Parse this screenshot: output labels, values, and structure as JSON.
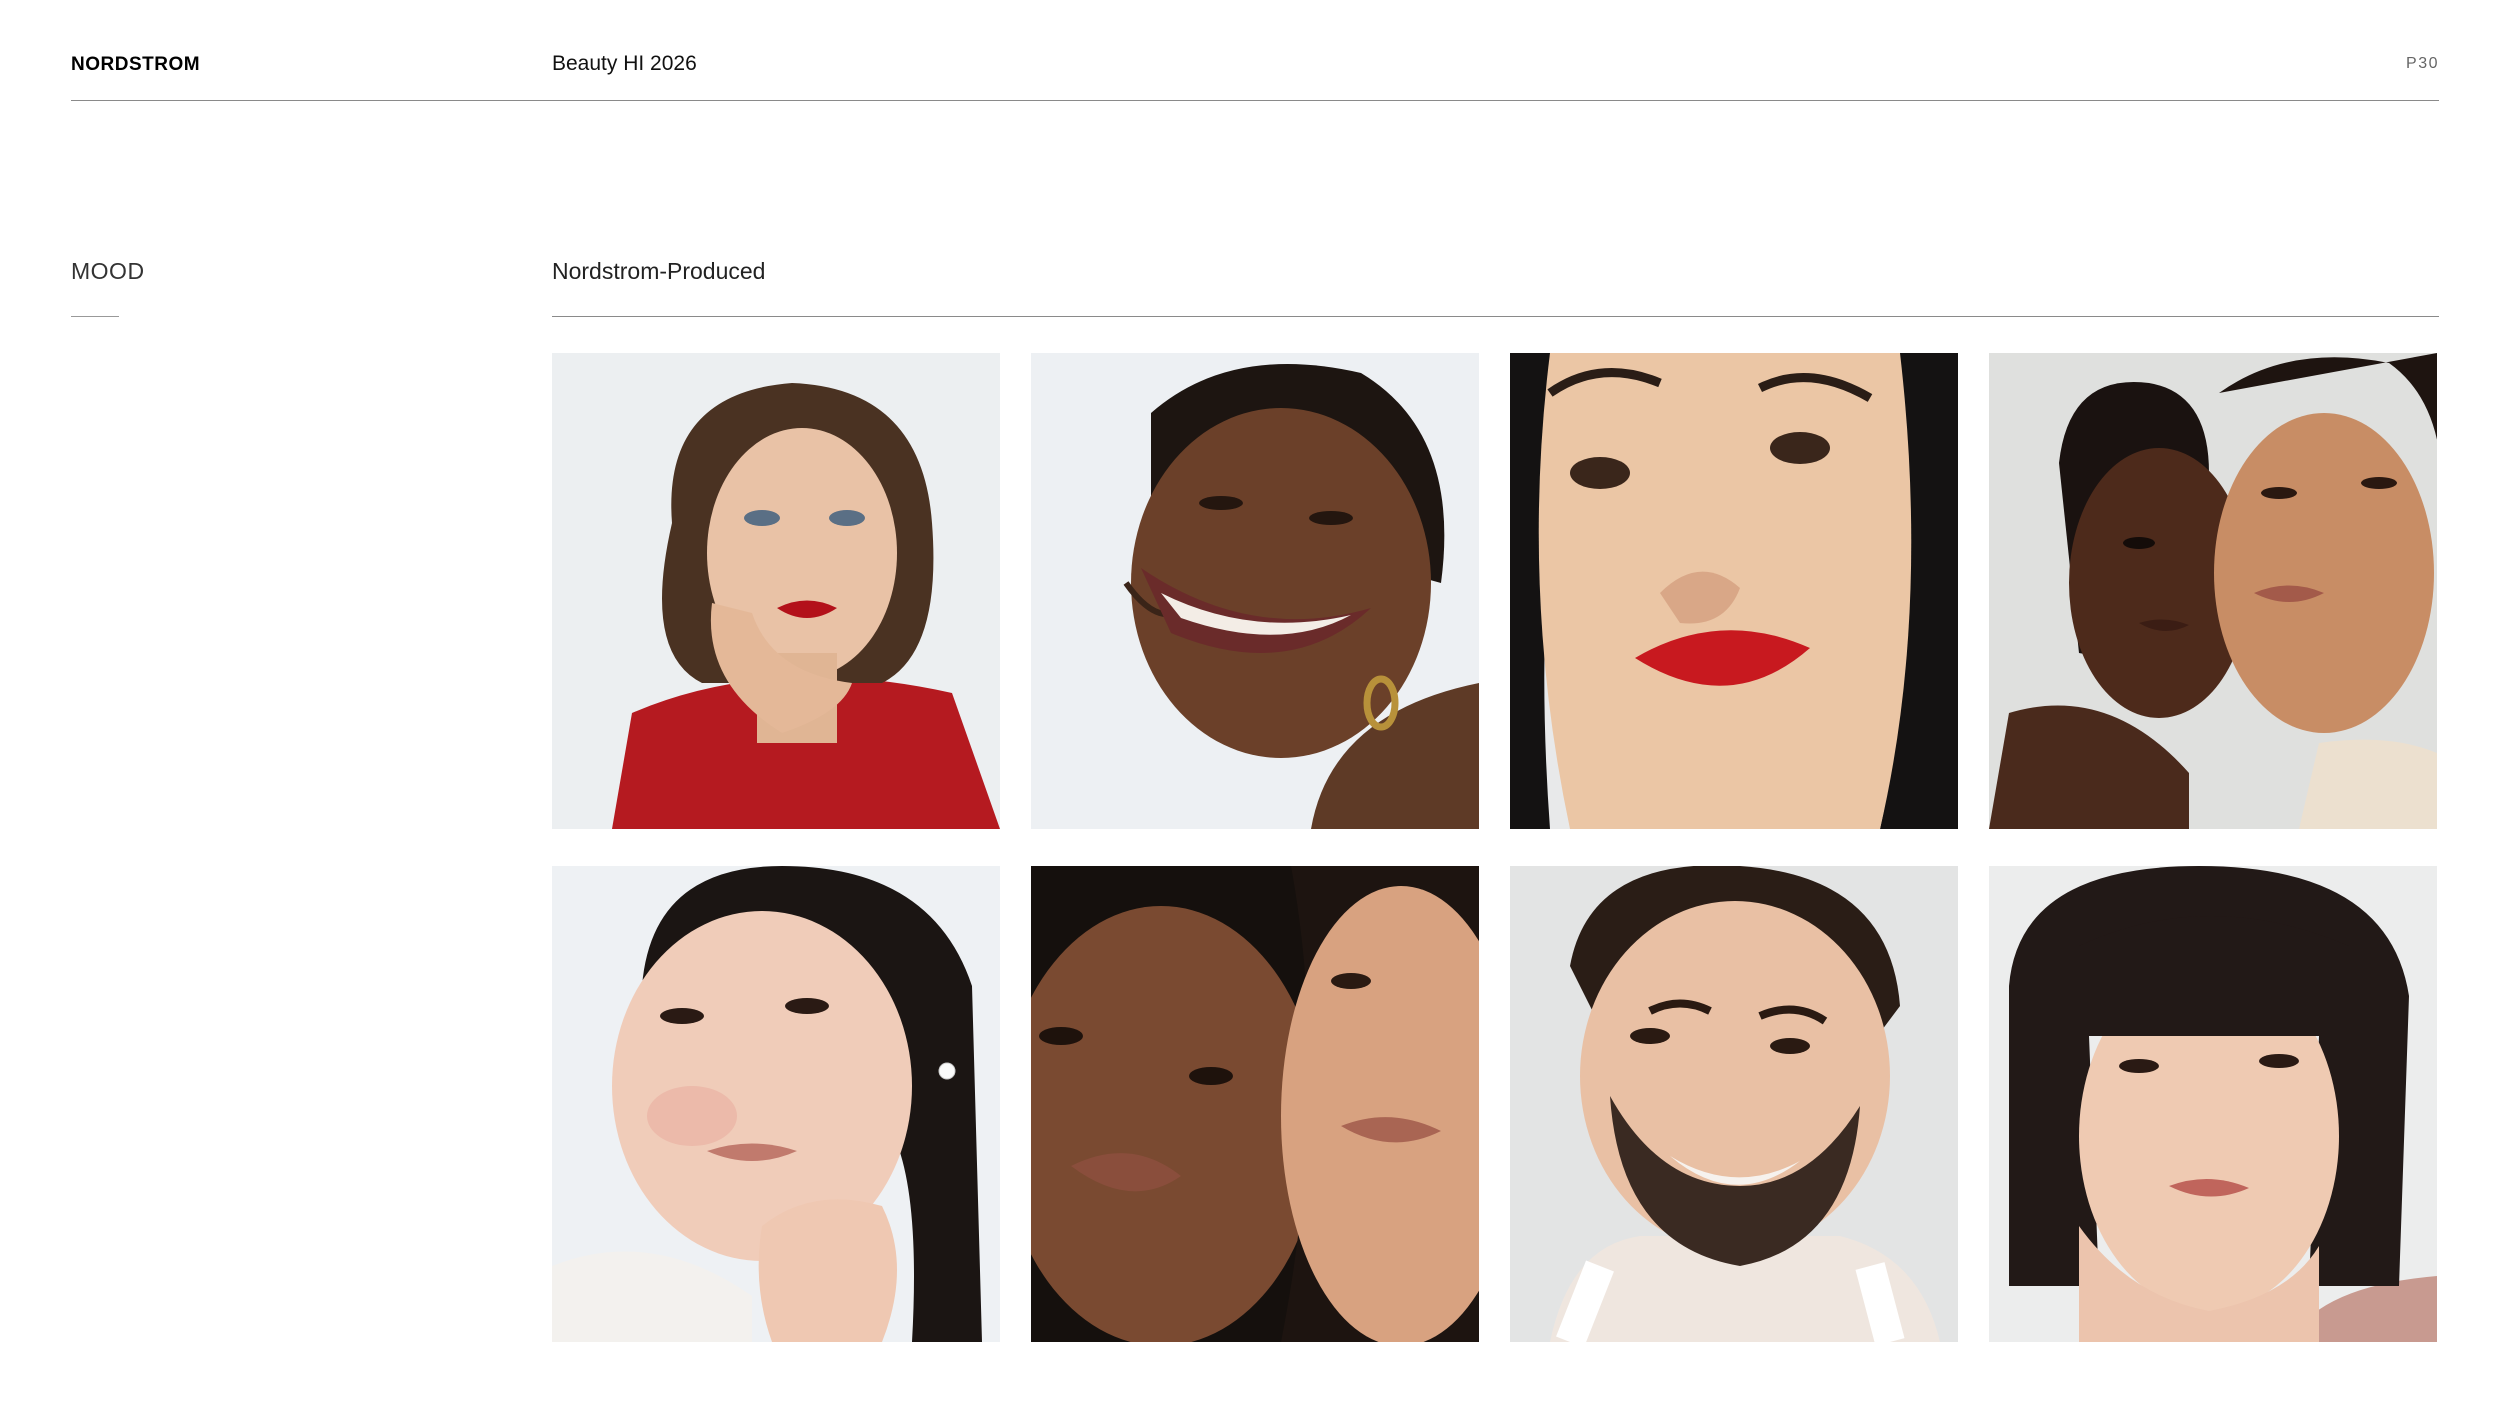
{
  "header": {
    "brand": "NORDSTROM",
    "title": "Beauty HI 2026",
    "page_number": "P30"
  },
  "section": {
    "label": "MOOD",
    "subtitle": "Nordstrom-Produced"
  },
  "colors": {
    "background": "#ffffff",
    "rule": "#8a8a8a",
    "lip_red": "#c0161c"
  },
  "photos": [
    {
      "icon": "portrait-photo"
    },
    {
      "icon": "portrait-photo"
    },
    {
      "icon": "portrait-photo"
    },
    {
      "icon": "portrait-photo"
    },
    {
      "icon": "portrait-photo"
    },
    {
      "icon": "portrait-photo"
    },
    {
      "icon": "portrait-photo"
    },
    {
      "icon": "portrait-photo"
    }
  ]
}
